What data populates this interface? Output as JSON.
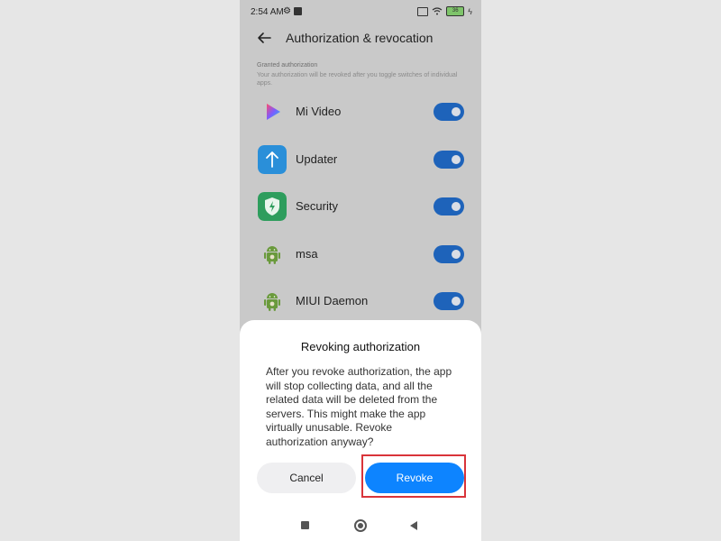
{
  "status_bar": {
    "time": "2:54 AM",
    "battery": "36"
  },
  "header": {
    "title": "Authorization & revocation"
  },
  "section": {
    "label": "Granted authorization",
    "description": "Your authorization will be revoked after you toggle switches of individual apps."
  },
  "apps": [
    {
      "name": "Mi Video",
      "icon": "mi-video-icon",
      "enabled": true
    },
    {
      "name": "Updater",
      "icon": "updater-icon",
      "enabled": true
    },
    {
      "name": "Security",
      "icon": "security-icon",
      "enabled": true
    },
    {
      "name": "msa",
      "icon": "android-icon",
      "enabled": true
    },
    {
      "name": "MIUI Daemon",
      "icon": "android-icon",
      "enabled": true
    }
  ],
  "dialog": {
    "title": "Revoking authorization",
    "body": "After you revoke authorization, the app will stop collecting data, and all the related data will be deleted from the servers. This might make the app virtually unusable. Revoke authorization anyway?",
    "cancel_label": "Cancel",
    "revoke_label": "Revoke"
  },
  "colors": {
    "accent": "#0d84ff",
    "toggle_on": "#1e63ba",
    "highlight": "#d9343a"
  }
}
